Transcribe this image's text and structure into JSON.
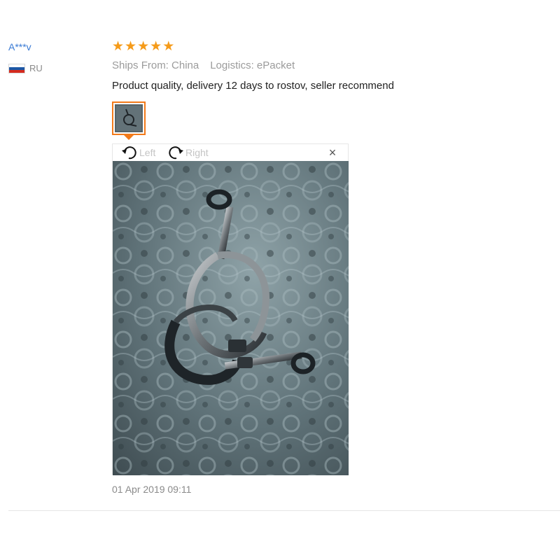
{
  "review": {
    "user_name": "A***v",
    "country_code": "RU",
    "rating": 5,
    "stars": [
      "★",
      "★",
      "★",
      "★",
      "★"
    ],
    "ships_from": "Ships From: China",
    "logistics": "Logistics: ePacket",
    "text": "Product quality, delivery 12 days to rostov, seller recommend",
    "date": "01 Apr 2019 09:11"
  },
  "viewer": {
    "rotate_left_label": "Left",
    "rotate_right_label": "Right",
    "close_symbol": "×",
    "rotate_left_icon": "rotate-left-icon",
    "rotate_right_icon": "rotate-right-icon",
    "close_icon": "close-icon",
    "photo_subject": "metal tri-clamp photo"
  },
  "colors": {
    "star": "#f59b1a",
    "thumb_border": "#f27a1a",
    "user_name": "#3a7bd5",
    "meta_text": "#9b9b9b",
    "flag_white": "#ffffff",
    "flag_blue": "#1c57a5",
    "flag_red": "#d52b1e"
  }
}
